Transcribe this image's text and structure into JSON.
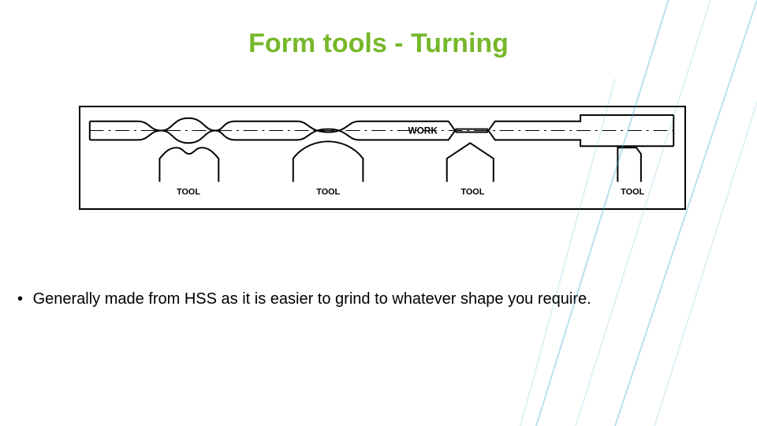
{
  "title": "Form tools - Turning",
  "diagram": {
    "work_label": "WORK",
    "tool_labels": [
      "TOOL",
      "TOOL",
      "TOOL",
      "TOOL"
    ]
  },
  "bullets": [
    "Generally made from HSS as it is easier to grind to whatever shape you require."
  ],
  "colors": {
    "accent": "#77b72b",
    "deco": "#3aa6d0"
  }
}
